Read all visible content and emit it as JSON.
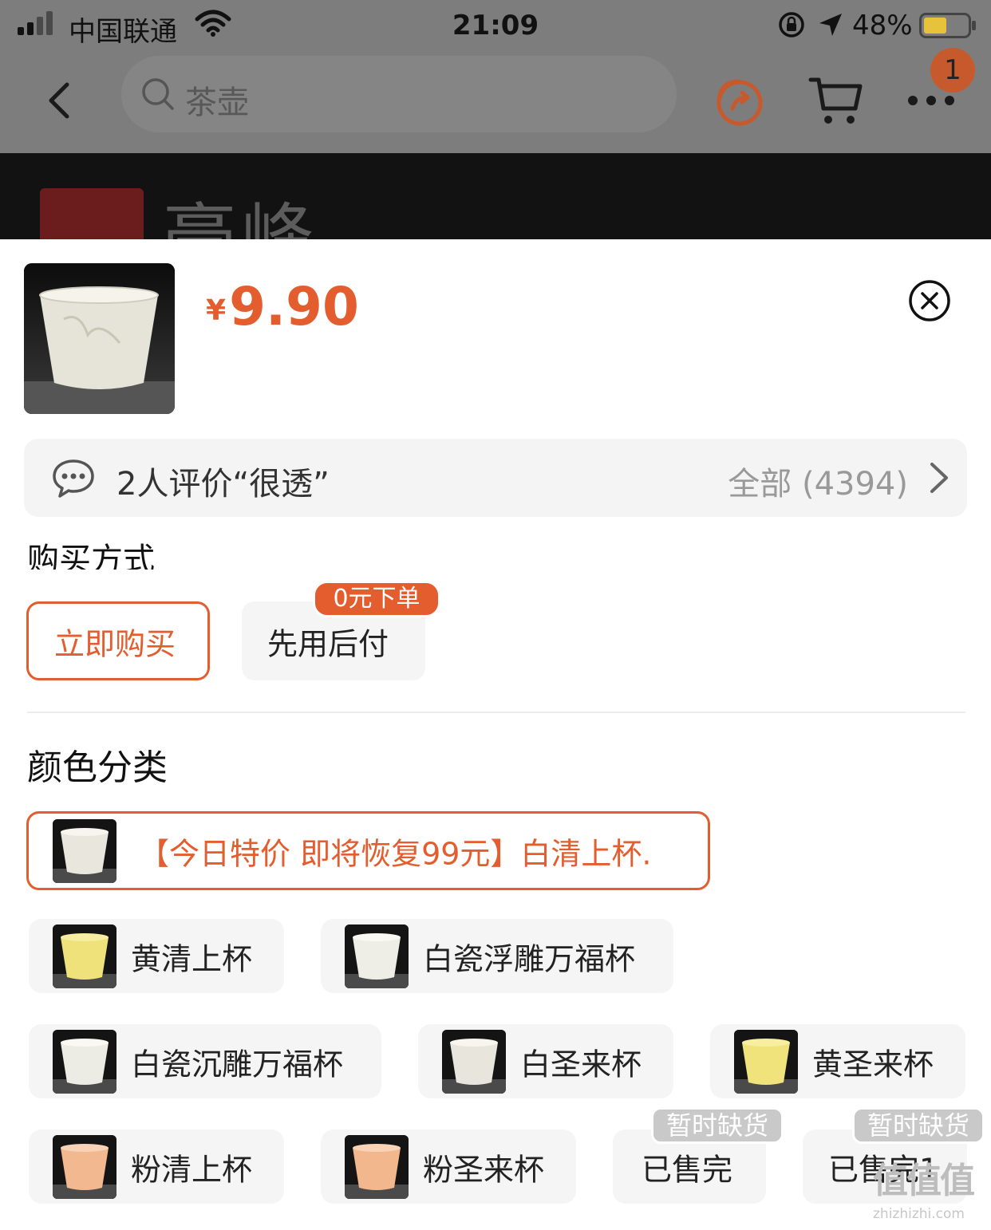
{
  "status_bar": {
    "carrier": "中国联通",
    "time": "21:09",
    "battery_pct": "48%"
  },
  "nav": {
    "search_query": "茶壶",
    "cart_badge": "1"
  },
  "product": {
    "currency": "¥",
    "price": "9.90"
  },
  "review": {
    "summary": "2人评价“很透”",
    "all_label": "全部 (4394)"
  },
  "purchase": {
    "section_label": "购买方式",
    "options": [
      {
        "label": "立即购买",
        "selected": true
      },
      {
        "label": "先用后付",
        "selected": false,
        "tag": "0元下单"
      }
    ]
  },
  "color": {
    "section_label": "颜色分类",
    "options": [
      {
        "label": "【今日特价 即将恢复99元】白清上杯.",
        "selected": true,
        "thumb": "white"
      },
      {
        "label": "黄清上杯",
        "thumb": "yellow"
      },
      {
        "label": "白瓷浮雕万福杯",
        "thumb": "white"
      },
      {
        "label": "白瓷沉雕万福杯",
        "thumb": "white"
      },
      {
        "label": "白圣来杯",
        "thumb": "white"
      },
      {
        "label": "黄圣来杯",
        "thumb": "yellow"
      },
      {
        "label": "粉清上杯",
        "thumb": "pink"
      },
      {
        "label": "粉圣来杯",
        "thumb": "pink"
      },
      {
        "label": "已售完",
        "tag": "暂时缺货"
      },
      {
        "label": "已售完1",
        "tag": "暂时缺货"
      }
    ]
  },
  "colors": {
    "accent": "#e35d2e",
    "option_bg": "#f5f5f5"
  }
}
